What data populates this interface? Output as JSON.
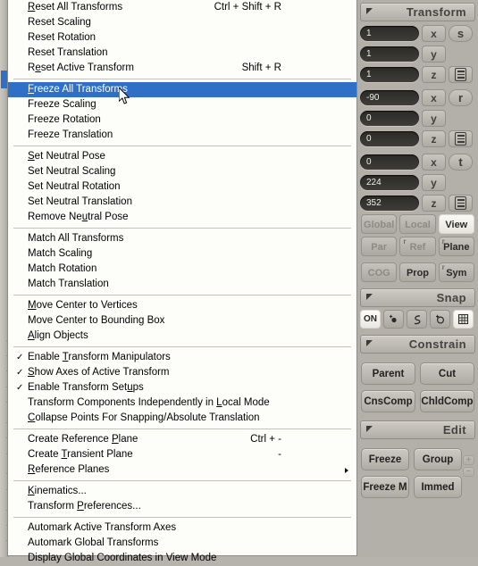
{
  "menu": {
    "groups": [
      {
        "items": [
          {
            "label": "Reset All Transforms",
            "mnemonic": "R",
            "accel": "Ctrl + Shift + R"
          },
          {
            "label": "Reset Scaling",
            "accel": ""
          },
          {
            "label": "Reset Rotation",
            "accel": ""
          },
          {
            "label": "Reset Translation",
            "accel": ""
          },
          {
            "label": "Reset Active Transform",
            "mnemonic": "e",
            "accel": "Shift + R"
          }
        ]
      },
      {
        "items": [
          {
            "label": "Freeze All Transforms",
            "mnemonic": "F",
            "accel": "",
            "selected": true
          },
          {
            "label": "Freeze Scaling",
            "accel": ""
          },
          {
            "label": "Freeze Rotation",
            "accel": ""
          },
          {
            "label": "Freeze Translation",
            "accel": ""
          }
        ]
      },
      {
        "items": [
          {
            "label": "Set Neutral Pose",
            "mnemonic": "S",
            "accel": ""
          },
          {
            "label": "Set Neutral Scaling",
            "accel": ""
          },
          {
            "label": "Set Neutral Rotation",
            "accel": ""
          },
          {
            "label": "Set Neutral Translation",
            "accel": ""
          },
          {
            "label": "Remove Neutral Pose",
            "mnemonic": "u",
            "accel": ""
          }
        ]
      },
      {
        "items": [
          {
            "label": "Match All Transforms",
            "accel": ""
          },
          {
            "label": "Match Scaling",
            "accel": ""
          },
          {
            "label": "Match Rotation",
            "accel": ""
          },
          {
            "label": "Match Translation",
            "accel": ""
          }
        ]
      },
      {
        "items": [
          {
            "label": "Move Center to Vertices",
            "mnemonic": "M",
            "accel": ""
          },
          {
            "label": "Move Center to Bounding Box",
            "accel": ""
          },
          {
            "label": "Align Objects",
            "mnemonic": "A",
            "accel": ""
          }
        ]
      },
      {
        "items": [
          {
            "label": "Enable Transform Manipulators",
            "mnemonic": "T",
            "accel": "",
            "checked": true
          },
          {
            "label": "Show Axes of Active Transform",
            "mnemonic": "S",
            "accel": "",
            "checked": true
          },
          {
            "label": "Enable Transform Setups",
            "mnemonic": "u",
            "accel": "",
            "checked": true
          },
          {
            "label": "Transform Components Independently in Local Mode",
            "mnemonic": "L",
            "accel": ""
          },
          {
            "label": "Collapse Points For Snapping/Absolute Translation",
            "mnemonic": "C",
            "accel": ""
          }
        ]
      },
      {
        "items": [
          {
            "label": "Create Reference Plane",
            "mnemonic": "P",
            "accel": "Ctrl + -"
          },
          {
            "label": "Create Transient Plane",
            "mnemonic": "T",
            "accel": "-"
          },
          {
            "label": "Reference Planes",
            "mnemonic": "R",
            "accel": "",
            "submenu": true
          }
        ]
      },
      {
        "items": [
          {
            "label": "Kinematics...",
            "mnemonic": "K",
            "accel": ""
          },
          {
            "label": "Transform Preferences...",
            "mnemonic": "P",
            "accel": ""
          }
        ]
      },
      {
        "items": [
          {
            "label": "Automark Active Transform Axes",
            "accel": ""
          },
          {
            "label": "Automark Global Transforms",
            "accel": ""
          },
          {
            "label": "Display Global Coordinates in View Mode",
            "accel": ""
          }
        ]
      }
    ]
  },
  "panel": {
    "transform": {
      "title": "Transform",
      "scale": {
        "x": "1",
        "y": "1",
        "z": "1",
        "tag": "s"
      },
      "rotation": {
        "x": "-90",
        "y": "0",
        "z": "0",
        "tag": "r"
      },
      "translation": {
        "x": "0",
        "y": "224",
        "z": "352",
        "tag": "t"
      },
      "axis_labels": {
        "x": "x",
        "y": "y",
        "z": "z"
      },
      "mode_row_1": [
        {
          "label": "Global",
          "active": false
        },
        {
          "label": "Local",
          "active": false
        },
        {
          "label": "View",
          "active": true
        }
      ],
      "mode_row_2": [
        {
          "label": "Par",
          "active": false,
          "corner": ""
        },
        {
          "label": "Ref",
          "active": false,
          "corner": "r"
        },
        {
          "label": "Plane",
          "active": false,
          "corner": "r",
          "dark": true
        }
      ],
      "mode_row_3": [
        {
          "label": "COG",
          "active": false,
          "corner": ""
        },
        {
          "label": "Prop",
          "active": false,
          "corner": "",
          "dark": true
        },
        {
          "label": "Sym",
          "active": false,
          "corner": "r",
          "dark": true
        }
      ]
    },
    "snap": {
      "title": "Snap",
      "buttons": [
        {
          "label": "ON",
          "icon": "on-text",
          "active": true
        },
        {
          "label": "",
          "icon": "point-icon",
          "active": false
        },
        {
          "label": "",
          "icon": "curve-icon",
          "active": false
        },
        {
          "label": "",
          "icon": "circle-icon",
          "active": false
        },
        {
          "label": "",
          "icon": "grid-icon",
          "active": false
        }
      ]
    },
    "constrain": {
      "title": "Constrain",
      "buttons": [
        "Parent",
        "Cut",
        "CnsComp",
        "ChldComp"
      ]
    },
    "edit": {
      "title": "Edit",
      "buttons": [
        "Freeze",
        "Group",
        "Freeze M",
        "Immed"
      ],
      "plus": "+",
      "minus": "−"
    }
  },
  "colors": {
    "menu_bg": "#fdfdfa",
    "highlight": "#2f6fc6",
    "panel_bg": "#b2b0a8",
    "field_bg": "#2b2a27"
  }
}
